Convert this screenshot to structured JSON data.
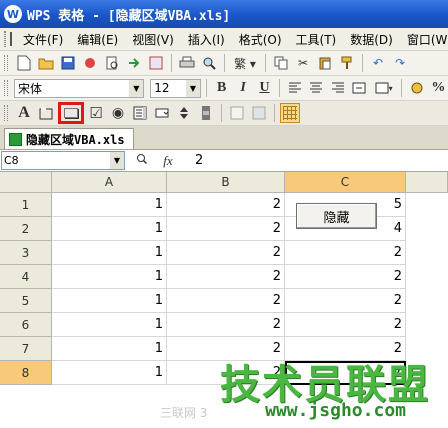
{
  "window": {
    "title": "WPS 表格 - [隐藏区域VBA.xls]",
    "logo_letter": "W"
  },
  "menu": [
    "文件(F)",
    "编辑(E)",
    "视图(V)",
    "插入(I)",
    "格式(O)",
    "工具(T)",
    "数据(D)",
    "窗口(W)"
  ],
  "toolbar2": {
    "font": "宋体",
    "size": "12",
    "bold": "B",
    "italic": "I",
    "underline": "U",
    "percent": "%"
  },
  "toolbar3": {
    "label_tool": "A",
    "checkbox_glyph": "☑",
    "radio_glyph": "◉"
  },
  "document_tab": "隐藏区域VBA.xls",
  "formula_bar": {
    "cell_ref": "C8",
    "value": "2",
    "fx": "fx"
  },
  "sheet": {
    "columns": [
      "A",
      "B",
      "C"
    ],
    "active_column": "C",
    "rows": [
      {
        "num": "1",
        "cells": [
          "1",
          "2",
          "5"
        ]
      },
      {
        "num": "2",
        "cells": [
          "1",
          "2",
          "4"
        ]
      },
      {
        "num": "3",
        "cells": [
          "1",
          "2",
          "2"
        ]
      },
      {
        "num": "4",
        "cells": [
          "1",
          "2",
          "2"
        ]
      },
      {
        "num": "5",
        "cells": [
          "1",
          "2",
          "2"
        ]
      },
      {
        "num": "6",
        "cells": [
          "1",
          "2",
          "2"
        ]
      },
      {
        "num": "7",
        "cells": [
          "1",
          "2",
          "2"
        ]
      },
      {
        "num": "8",
        "cells": [
          "1",
          "2",
          "2"
        ]
      }
    ],
    "active_row": "8",
    "button_label": "隐藏"
  },
  "watermark": {
    "brand": "技术员联盟",
    "url": "www.jsgho.com",
    "left_text": "三联网 3"
  }
}
